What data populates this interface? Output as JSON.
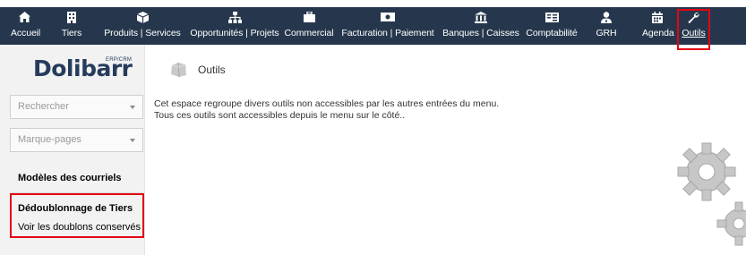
{
  "menu": {
    "items": [
      {
        "label": "Accueil",
        "icon": "home-icon"
      },
      {
        "label": "Tiers",
        "icon": "building-icon"
      },
      {
        "label": "Produits | Services",
        "icon": "cube-icon"
      },
      {
        "label": "Opportunités | Projets",
        "icon": "sitemap-icon"
      },
      {
        "label": "Commercial",
        "icon": "briefcase-icon"
      },
      {
        "label": "Facturation | Paiement",
        "icon": "money-icon"
      },
      {
        "label": "Banques | Caisses",
        "icon": "bank-icon"
      },
      {
        "label": "Comptabilité",
        "icon": "calculator-icon"
      },
      {
        "label": "GRH",
        "icon": "user-tie-icon"
      },
      {
        "label": "Agenda",
        "icon": "calendar-icon"
      },
      {
        "label": "Outils",
        "icon": "wrench-icon",
        "active": true
      }
    ],
    "colors": {
      "background": "#26374d",
      "text": "#ffffff",
      "highlight": "#e30613"
    }
  },
  "logo": {
    "text": "Dolibarr",
    "erp_label": "ERP/CRM"
  },
  "sidebar": {
    "search_placeholder": "Rechercher",
    "bookmarks_placeholder": "Marque-pages",
    "section1_title": "Modèles des courriels",
    "section2_title": "Dédoublonnage de Tiers",
    "section2_link": "Voir les doublons conservés"
  },
  "main": {
    "title": "Outils",
    "line1": "Cet espace regroupe divers outils non accessibles par les autres entrées du menu.",
    "line2": "Tous ces outils sont accessibles depuis le menu sur le côté.."
  }
}
